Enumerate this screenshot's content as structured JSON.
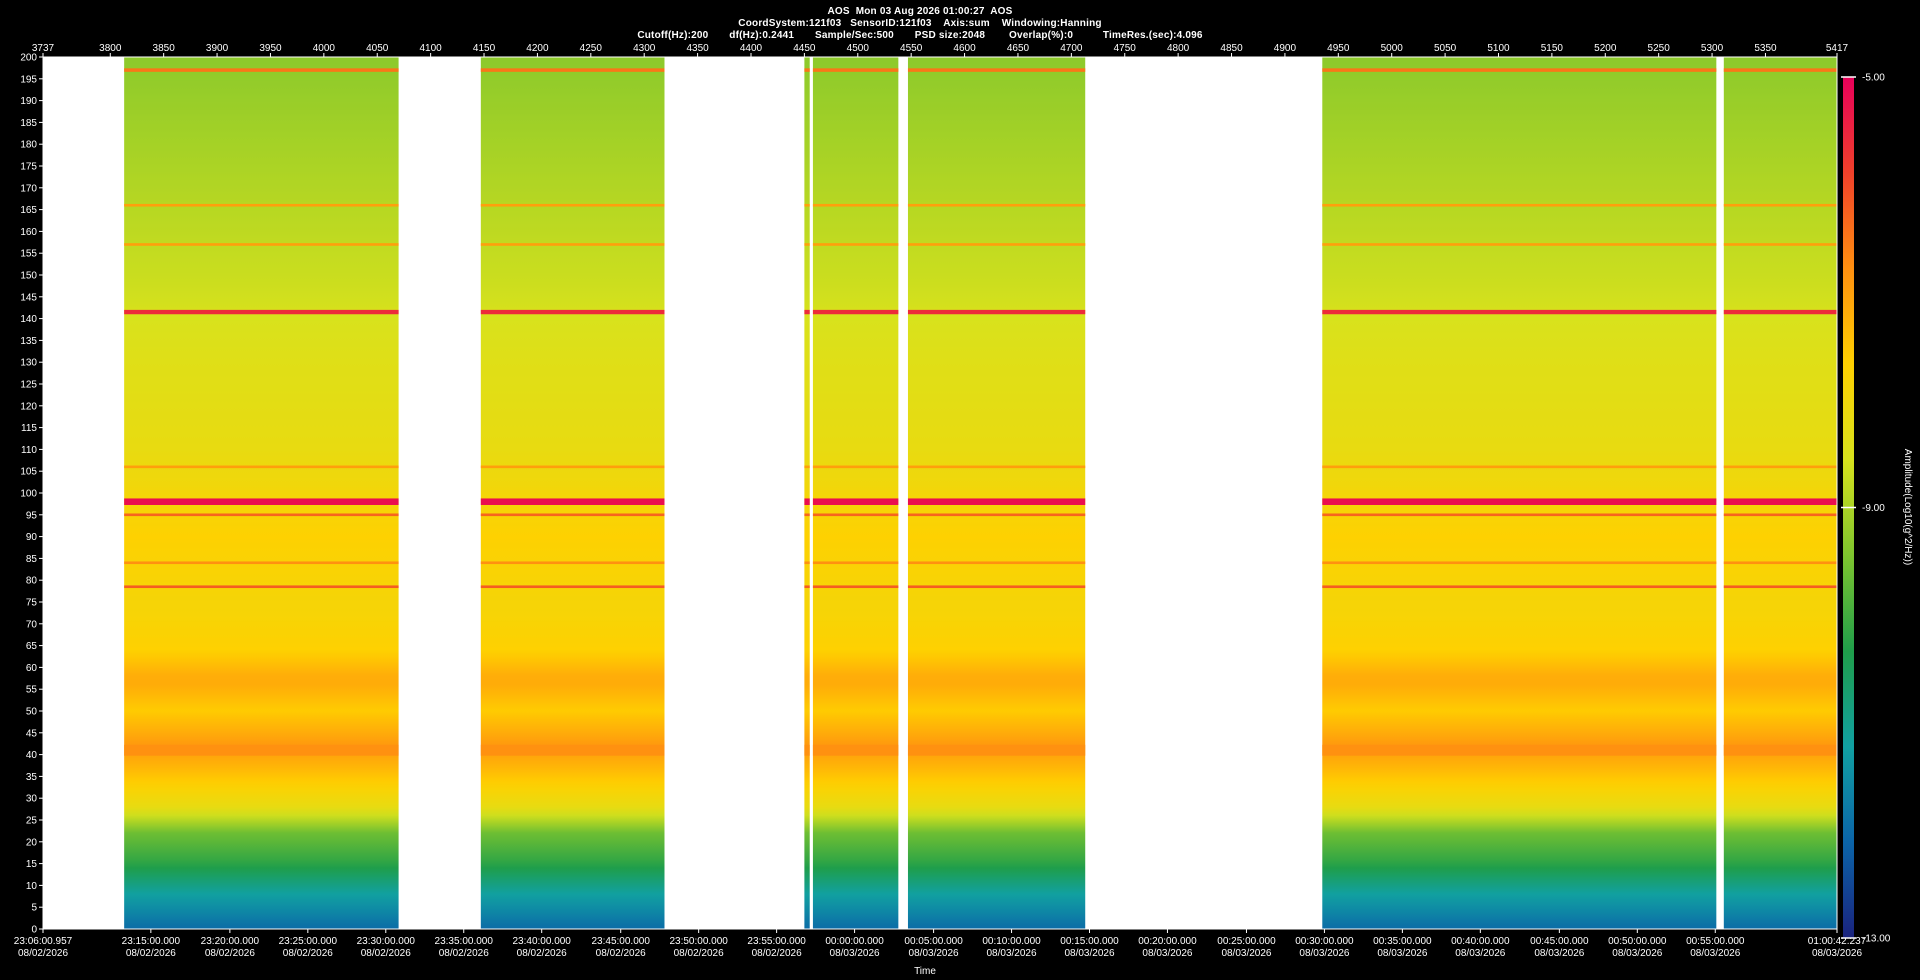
{
  "header": {
    "line1": "AOS  Mon 03 Aug 2026 01:00:27  AOS",
    "line2": "CoordSystem:121f03   SensorID:121f03    Axis:sum    Windowing:Hanning",
    "line3": "Cutoff(Hz):200       df(Hz):0.2441       Sample/Sec:500       PSD size:2048        Overlap(%):0          TimeRes.(sec):4.096"
  },
  "colors": {
    "background": "#000000",
    "gap": "#ffffff",
    "colormap": [
      "#1a237e",
      "#0b64a8",
      "#11a0a2",
      "#1f9e4a",
      "#7ec52e",
      "#d8e21c",
      "#ffd000",
      "#ff8f10",
      "#f0402a",
      "#e8005a"
    ]
  },
  "chart_data": {
    "type": "heatmap",
    "title": "",
    "xlabel": "Time",
    "ylabel": "",
    "colorbar_label": "Amplitude(Log10(g^2/Hz))",
    "colorbar_range": [
      -13.0,
      -5.0
    ],
    "colorbar_ticks": [
      "-5.00",
      "-9.00",
      "-13.00"
    ],
    "ylim": [
      0,
      200
    ],
    "y_ticks": [
      0,
      5,
      10,
      15,
      20,
      25,
      30,
      35,
      40,
      45,
      50,
      55,
      60,
      65,
      70,
      75,
      80,
      85,
      90,
      95,
      100,
      105,
      110,
      115,
      120,
      125,
      130,
      135,
      140,
      145,
      150,
      155,
      160,
      165,
      170,
      175,
      180,
      185,
      190,
      195,
      200
    ],
    "x_top_range": [
      3737,
      5417
    ],
    "x_top_ticks": [
      "3737",
      "3800",
      "3850",
      "3900",
      "3950",
      "4000",
      "4050",
      "4100",
      "4150",
      "4200",
      "4250",
      "4300",
      "4350",
      "4400",
      "4450",
      "4500",
      "4550",
      "4600",
      "4650",
      "4700",
      "4750",
      "4800",
      "4850",
      "4900",
      "4950",
      "5000",
      "5050",
      "5100",
      "5150",
      "5200",
      "5250",
      "5300",
      "5350",
      "5417"
    ],
    "x_bottom_ticks": [
      {
        "idx": 3737,
        "time": "23:06:00.957",
        "date": "08/02/2026"
      },
      {
        "idx": 3838,
        "time": "23:15:00.000",
        "date": "08/02/2026"
      },
      {
        "idx": 3912,
        "time": "23:20:00.000",
        "date": "08/02/2026"
      },
      {
        "idx": 3985,
        "time": "23:25:00.000",
        "date": "08/02/2026"
      },
      {
        "idx": 4058,
        "time": "23:30:00.000",
        "date": "08/02/2026"
      },
      {
        "idx": 4131,
        "time": "23:35:00.000",
        "date": "08/02/2026"
      },
      {
        "idx": 4204,
        "time": "23:40:00.000",
        "date": "08/02/2026"
      },
      {
        "idx": 4278,
        "time": "23:45:00.000",
        "date": "08/02/2026"
      },
      {
        "idx": 4351,
        "time": "23:50:00.000",
        "date": "08/02/2026"
      },
      {
        "idx": 4424,
        "time": "23:55:00.000",
        "date": "08/02/2026"
      },
      {
        "idx": 4497,
        "time": "00:00:00.000",
        "date": "08/03/2026"
      },
      {
        "idx": 4571,
        "time": "00:05:00.000",
        "date": "08/03/2026"
      },
      {
        "idx": 4644,
        "time": "00:10:00.000",
        "date": "08/03/2026"
      },
      {
        "idx": 4717,
        "time": "00:15:00.000",
        "date": "08/03/2026"
      },
      {
        "idx": 4790,
        "time": "00:20:00.000",
        "date": "08/03/2026"
      },
      {
        "idx": 4864,
        "time": "00:25:00.000",
        "date": "08/03/2026"
      },
      {
        "idx": 4937,
        "time": "00:30:00.000",
        "date": "08/03/2026"
      },
      {
        "idx": 5010,
        "time": "00:35:00.000",
        "date": "08/03/2026"
      },
      {
        "idx": 5083,
        "time": "00:40:00.000",
        "date": "08/03/2026"
      },
      {
        "idx": 5157,
        "time": "00:45:00.000",
        "date": "08/03/2026"
      },
      {
        "idx": 5230,
        "time": "00:50:00.000",
        "date": "08/03/2026"
      },
      {
        "idx": 5303,
        "time": "00:55:00.000",
        "date": "08/03/2026"
      },
      {
        "idx": 5417,
        "time": "01:00:42.237",
        "date": "08/03/2026"
      }
    ],
    "data_segments": [
      [
        3813,
        4070
      ],
      [
        4147,
        4319
      ],
      [
        4450,
        4455
      ],
      [
        4458,
        4538
      ],
      [
        4547,
        4713
      ],
      [
        4935,
        5304
      ],
      [
        5311,
        5417
      ]
    ],
    "spectral_bands": [
      {
        "freq": 197,
        "level": -6.5,
        "width": 0.8
      },
      {
        "freq": 166,
        "level": -7.0,
        "width": 0.6
      },
      {
        "freq": 157,
        "level": -7.0,
        "width": 0.6
      },
      {
        "freq": 141.5,
        "level": -5.6,
        "width": 1.0
      },
      {
        "freq": 106,
        "level": -7.0,
        "width": 0.6
      },
      {
        "freq": 98,
        "level": -5.2,
        "width": 1.5
      },
      {
        "freq": 95,
        "level": -6.3,
        "width": 0.6
      },
      {
        "freq": 84,
        "level": -6.8,
        "width": 0.6
      },
      {
        "freq": 78.5,
        "level": -6.2,
        "width": 0.6
      },
      {
        "freq": 41,
        "level": -6.8,
        "width": 2.5
      }
    ]
  }
}
